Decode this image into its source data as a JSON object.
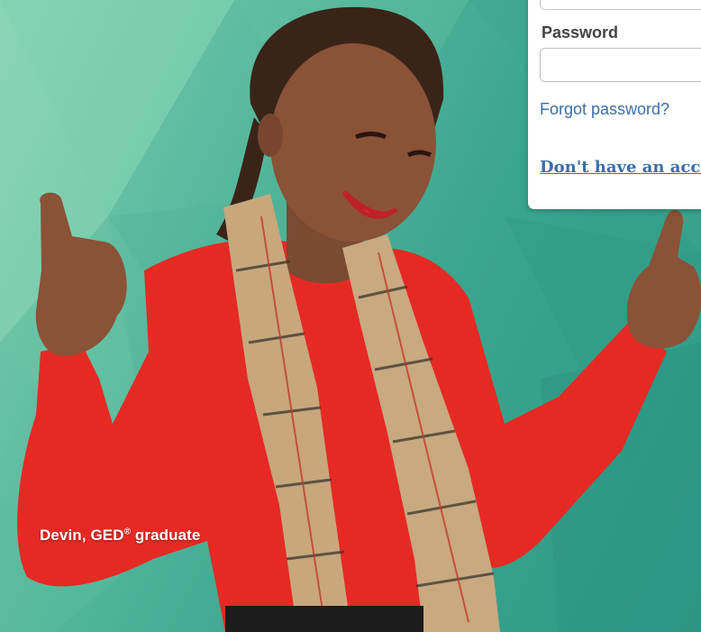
{
  "login": {
    "password_label": "Password",
    "forgot_password": "Forgot password?",
    "signup_prompt": "Don't have an acco"
  },
  "hero": {
    "caption_name": "Devin, GED",
    "caption_mark": "®",
    "caption_role": "graduate"
  },
  "colors": {
    "hero_background": "#3aa58d",
    "link": "#3a6fa8",
    "sweater": "#e52a24",
    "scarf": "#c8a77d"
  }
}
